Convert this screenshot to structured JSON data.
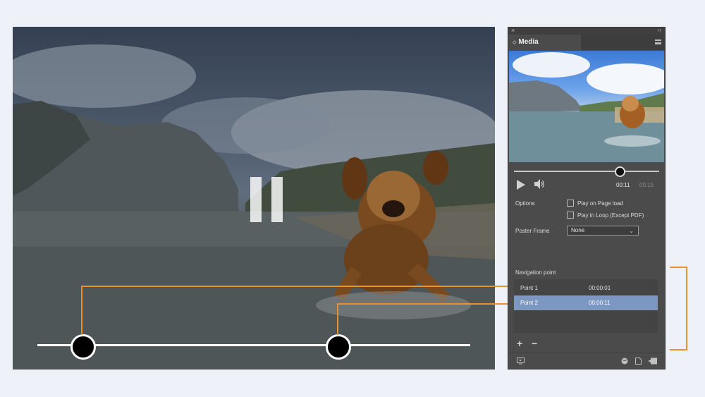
{
  "panel": {
    "title": "Media",
    "close_glyph": "×",
    "collapse_glyph": "‹‹",
    "playback": {
      "current_time": "00:11",
      "total_time": "00:15",
      "progress_fraction": 0.73
    },
    "options_label": "Options",
    "play_on_page_load_label": "Play on Page load",
    "play_in_loop_label": "Play in Loop (Except PDF)",
    "poster_frame_label": "Poster Frame",
    "poster_frame_value": "None",
    "navigation_label": "Navigation point",
    "navigation_points": [
      {
        "name": "Point 1",
        "time": "00:00:01",
        "selected": false
      },
      {
        "name": "Point 2",
        "time": "00:00:11",
        "selected": true
      }
    ],
    "add_glyph": "+",
    "remove_glyph": "−"
  },
  "icons": [
    "pause-icon",
    "play-icon",
    "volume-icon",
    "close-icon",
    "collapse-icon",
    "panel-menu-icon",
    "chevron-down-icon",
    "add-icon",
    "remove-icon",
    "preview-icon",
    "globe-icon",
    "page-icon",
    "export-icon"
  ],
  "colors": {
    "accent_orange": "#e8922a",
    "panel_bg": "#4b4b4b",
    "selected_row": "#7c97c1",
    "page_bg": "#eef2f8"
  }
}
